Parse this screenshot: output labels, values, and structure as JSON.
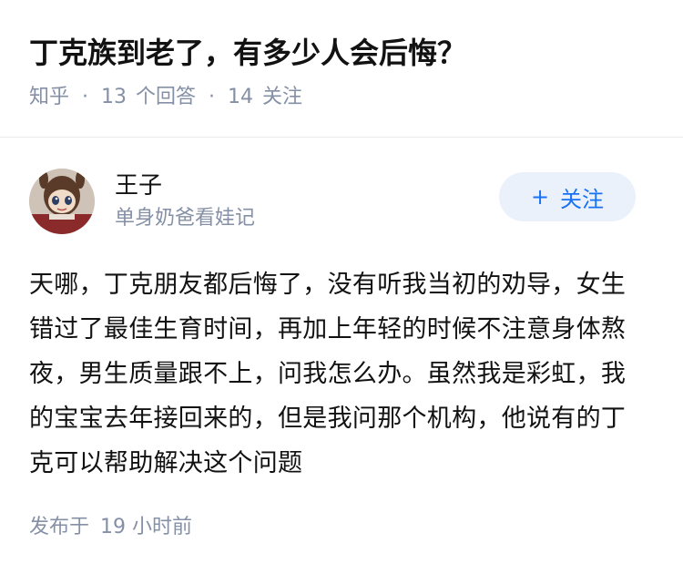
{
  "question": {
    "title": "丁克族到老了，有多少人会后悔？",
    "source": "知乎",
    "answers_count": "13",
    "answers_label": "个回答",
    "follows_count": "14",
    "follows_label": "关注",
    "separator": "·"
  },
  "answer": {
    "author_name": "王子",
    "author_bio": "单身奶爸看娃记",
    "follow_button": {
      "icon": "+",
      "label": "关注"
    },
    "content": "天哪，丁克朋友都后悔了，没有听我当初的劝导，女生错过了最佳生育时间，再加上年轻的时候不注意身体熬夜，男生质量跟不上，问我怎么办。虽然我是彩虹，我的宝宝去年接回来的，但是我问那个机构，他说有的丁克可以帮助解决这个问题",
    "published_label": "发布于",
    "published_time": "19 小时前"
  },
  "colors": {
    "meta_gray": "#8590a6",
    "follow_bg": "#ebf1fa",
    "follow_text": "#1772f6"
  },
  "icons": {
    "avatar": "avatar-doll-image"
  }
}
